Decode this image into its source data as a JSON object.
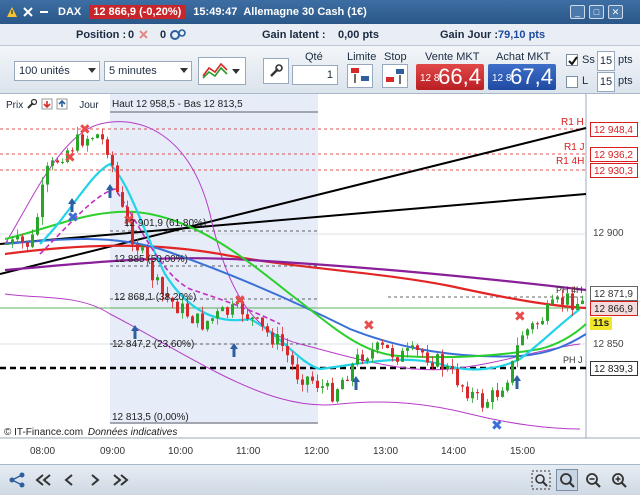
{
  "titlebar": {
    "instrument": "DAX",
    "price_change": "12 866,9 (-0,20%)",
    "time": "15:49:47",
    "name": "Allemagne 30 Cash (1€)"
  },
  "infobar": {
    "position_label": "Position :",
    "position_value": "0",
    "orders_value": "0",
    "latent_label": "Gain latent :",
    "latent_value": "0,00 pts",
    "day_label": "Gain Jour :",
    "day_value": "79,10 pts"
  },
  "toolbar": {
    "units_value": "100 unités",
    "interval_value": "5 minutes",
    "qty_label": "Qté",
    "qty_value": "1",
    "limit_label": "Limite",
    "stop_label": "Stop",
    "sell_label": "Vente MKT",
    "sell_prefix": "12 8",
    "sell_big": "66,4",
    "buy_label": "Achat MKT",
    "buy_prefix": "12 8",
    "buy_big": "67,4",
    "ss_label": "Ss",
    "ss_value": "15",
    "ss_unit": "pts",
    "l_label": "L",
    "l_value": "15",
    "l_unit": "pts"
  },
  "chart": {
    "legend_prix": "Prix",
    "legend_jour": "Jour",
    "fib_header": "Haut 12 958,5 - Bas 12 813,5",
    "fib_levels": [
      {
        "label": "12 901,9 (61,80%)"
      },
      {
        "label": "12 885 (50,00%)"
      },
      {
        "label": "12 868,1 (38,20%)"
      },
      {
        "label": "12 847,2 (23,60%)"
      },
      {
        "label": "12 813,5 (0,00%)"
      }
    ],
    "pivot_labels": [
      {
        "text": "R1 H"
      },
      {
        "text": "R1 J"
      },
      {
        "text": "R1 4H"
      },
      {
        "text": "PH 4H"
      },
      {
        "text": "PH J"
      }
    ],
    "price_tags": [
      {
        "text": "12 948,4",
        "color": "#d81e1e"
      },
      {
        "text": "12 936,2",
        "color": "#d81e1e"
      },
      {
        "text": "12 930,3",
        "color": "#d81e1e"
      },
      {
        "text": "12 900",
        "color": "#444444"
      },
      {
        "text": "12 871,9",
        "color": "#444444"
      },
      {
        "text": "12 866,9",
        "color": "#d81e1e"
      },
      {
        "text": "12 850",
        "color": "#444444"
      },
      {
        "text": "12 839,3",
        "color": "#444444"
      }
    ],
    "countdown": "11s",
    "footer_brand": "© IT-Finance.com",
    "footer_note": "Données indicatives",
    "x_ticks": [
      "08:00",
      "09:00",
      "10:00",
      "11:00",
      "12:00",
      "13:00",
      "14:00",
      "15:00"
    ]
  },
  "icons": [
    "close-icon",
    "settings-icon",
    "pen-tool-icon",
    "chart-type-icon",
    "zoom-icon",
    "search-icon",
    "share-icon"
  ]
}
